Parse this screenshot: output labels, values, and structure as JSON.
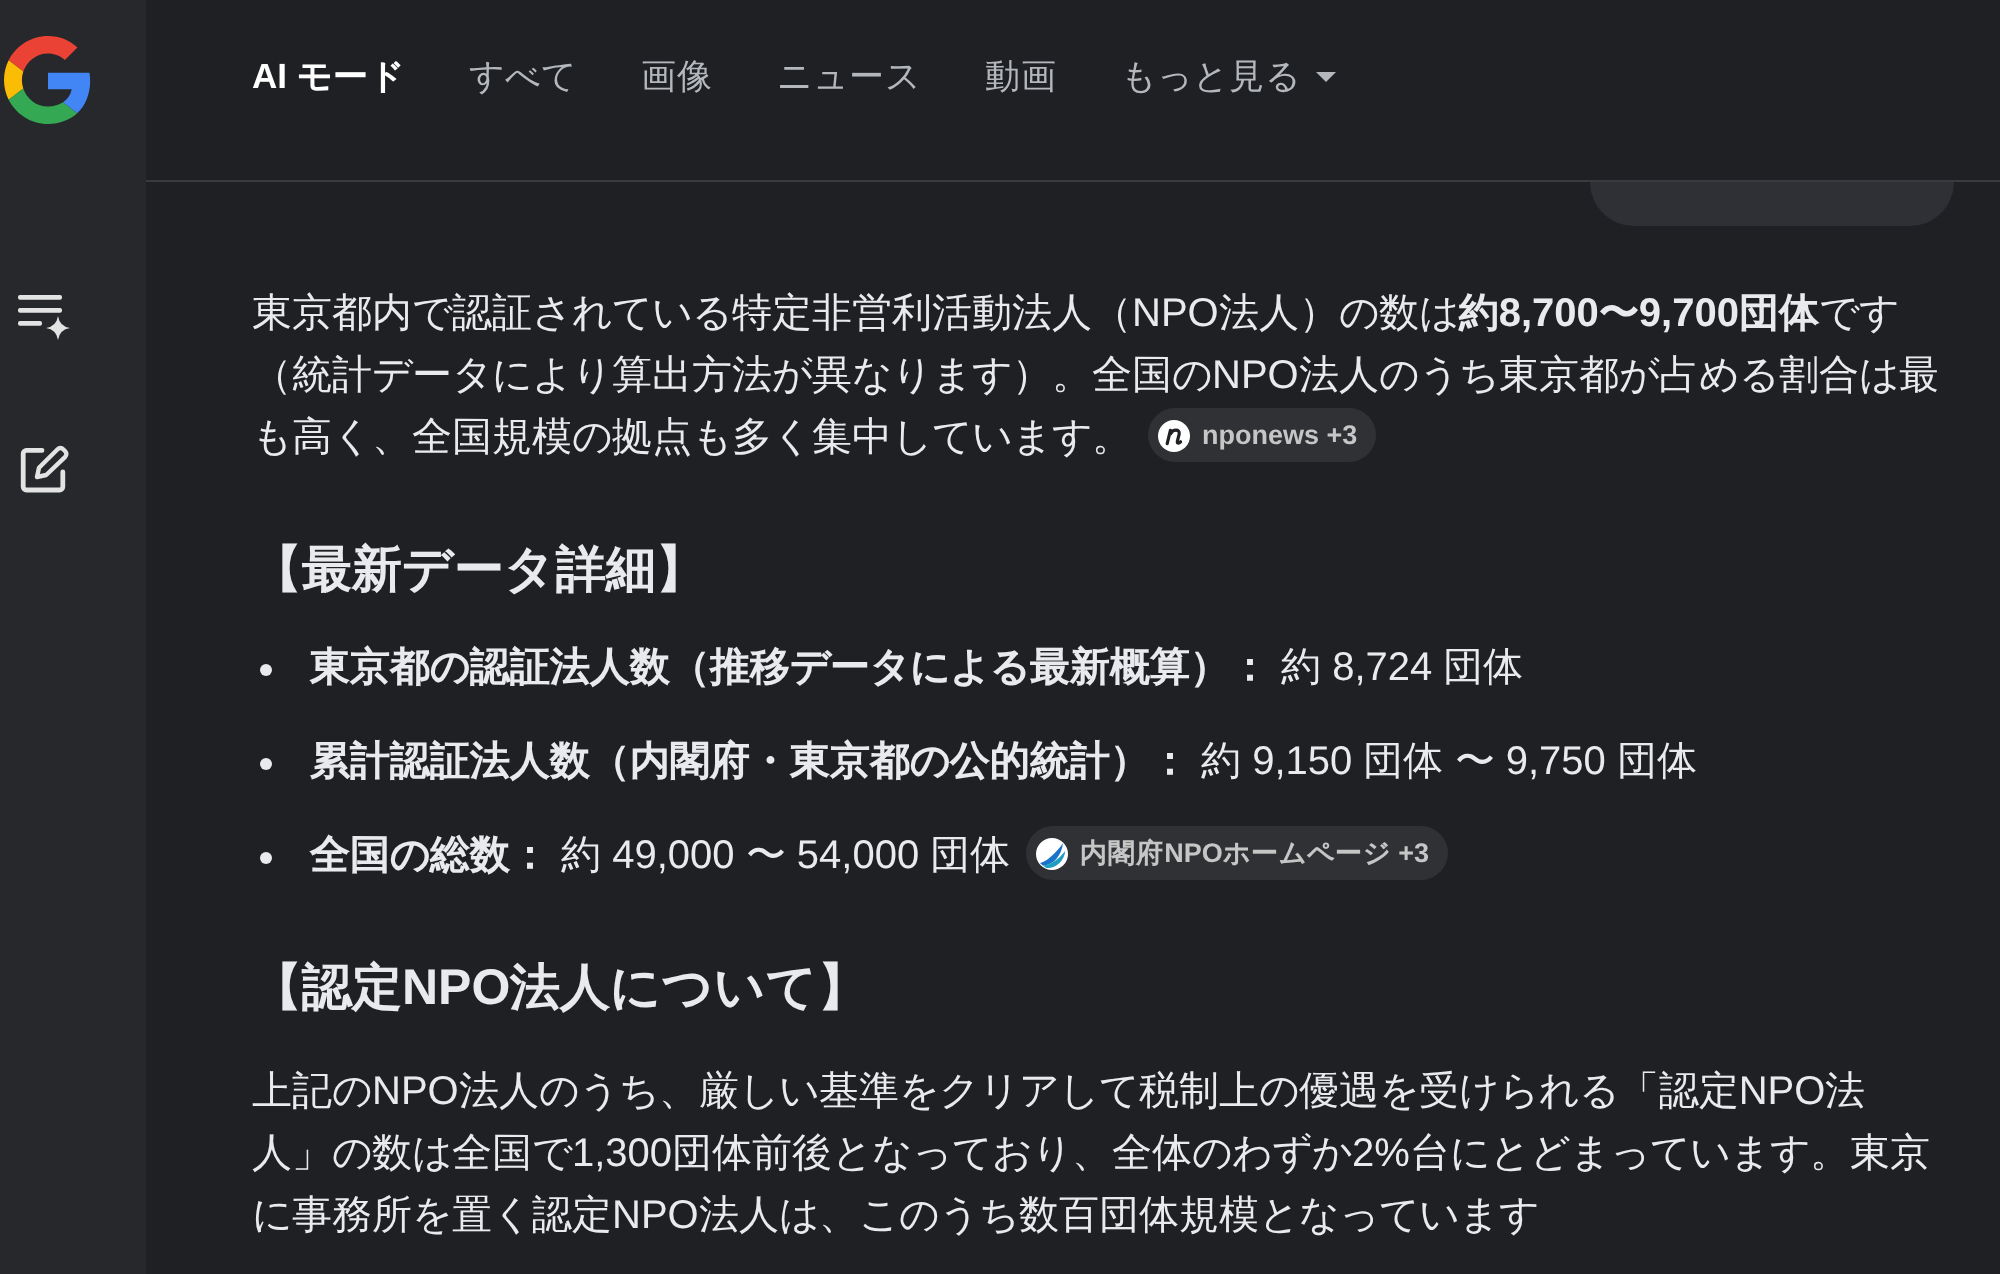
{
  "tabs": [
    {
      "label": "AI モード",
      "selected": true,
      "kind": "tab"
    },
    {
      "label": "すべて",
      "selected": false,
      "kind": "tab"
    },
    {
      "label": "画像",
      "selected": false,
      "kind": "tab"
    },
    {
      "label": "ニュース",
      "selected": false,
      "kind": "tab"
    },
    {
      "label": "動画",
      "selected": false,
      "kind": "tab"
    },
    {
      "label": "もっと見る",
      "selected": false,
      "kind": "dropdown"
    }
  ],
  "answer": {
    "intro": {
      "text": "東京都内で認証されている特定非営利活動法人（NPO法人）の数は**約8,700〜9,700団体**です（統計データにより算出方法が異なります）。全国のNPO法人のうち東京都が占める割合は最も高く、全国規模の拠点も多く集中しています。",
      "source": {
        "name": "nponews",
        "more": "+3"
      }
    },
    "sections": [
      {
        "heading": "【最新データ詳細】",
        "bullets": [
          {
            "text": "**東京都の認証法人数（推移データによる最新概算）：** 約 8,724 団体"
          },
          {
            "text": "**累計認証法人数（内閣府・東京都の公的統計）：** 約 9,150 団体 〜 9,750 団体"
          },
          {
            "text": "**全国の総数：** 約 49,000 〜 54,000 団体",
            "source": {
              "name": "内閣府NPOホームページ",
              "more": "+3"
            }
          }
        ]
      },
      {
        "heading": "【認定NPO法人について】",
        "paragraph": {
          "text": "上記のNPO法人のうち、厳しい基準をクリアして税制上の優遇を受けられる「認定NPO法人」の数は全国で1,300団体前後となっており、全体のわずか2%台にとどまっています。東京に事務所を置く認定NPO法人は、このうち数百団体規模となっています"
        }
      }
    ]
  }
}
